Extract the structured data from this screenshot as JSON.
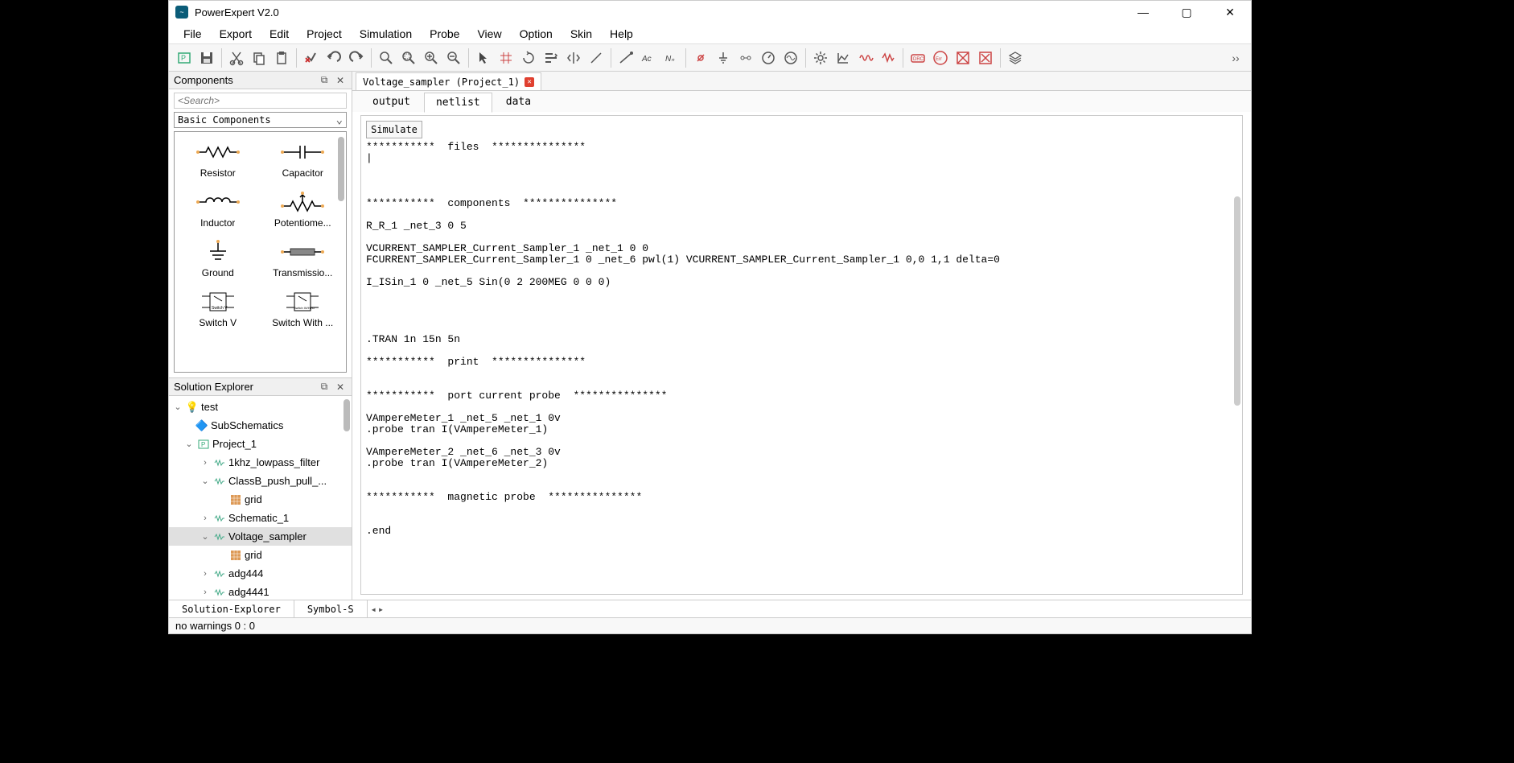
{
  "title": "PowerExpert V2.0",
  "menu": [
    "File",
    "Export",
    "Edit",
    "Project",
    "Simulation",
    "Probe",
    "View",
    "Option",
    "Skin",
    "Help"
  ],
  "componentsPanel": {
    "title": "Components",
    "searchPlaceholder": "<Search>",
    "category": "Basic Components",
    "items": [
      "Resistor",
      "Capacitor",
      "Inductor",
      "Potentiome...",
      "Ground",
      "Transmissio...",
      "Switch V",
      "Switch With ..."
    ]
  },
  "solutionPanel": {
    "title": "Solution Explorer",
    "tree": {
      "root": "test",
      "sub": "SubSchematics",
      "project": "Project_1",
      "children": [
        "1khz_lowpass_filter",
        "ClassB_push_pull_...",
        "Schematic_1",
        "Voltage_sampler",
        "adg444",
        "adg4441"
      ],
      "grid": "grid"
    }
  },
  "bottomTabs": {
    "a": "Solution-Explorer",
    "b": "Symbol-S"
  },
  "status": "no warnings  0 : 0",
  "editor": {
    "tabTitle": "Voltage_sampler (Project_1)",
    "subtabs": [
      "output",
      "netlist",
      "data"
    ],
    "activeSubtab": 1,
    "simulate": "Simulate",
    "code": "***********  files  ***************\n|\n\n\n\n***********  components  ***************\n\nR_R_1 _net_3 0 5\n\nVCURRENT_SAMPLER_Current_Sampler_1 _net_1 0 0\nFCURRENT_SAMPLER_Current_Sampler_1 0 _net_6 pwl(1) VCURRENT_SAMPLER_Current_Sampler_1 0,0 1,1 delta=0\n\nI_ISin_1 0 _net_5 Sin(0 2 200MEG 0 0 0)\n\n\n\n\n.TRAN 1n 15n 5n\n\n***********  print  ***************\n\n\n***********  port current probe  ***************\n\nVAmpereMeter_1 _net_5 _net_1 0v\n.probe tran I(VAmpereMeter_1)\n\nVAmpereMeter_2 _net_6 _net_3 0v\n.probe tran I(VAmpereMeter_2)\n\n\n***********  magnetic probe  ***************\n\n\n.end"
  }
}
